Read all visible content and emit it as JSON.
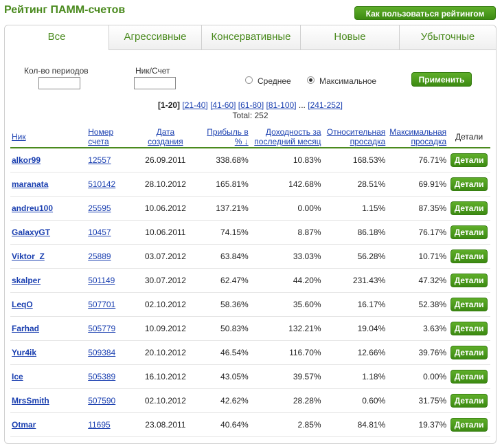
{
  "page": {
    "title": "Рейтинг ПАММ-счетов",
    "help_button": "Как пользоваться рейтингом"
  },
  "tabs": [
    {
      "label": "Все",
      "active": true
    },
    {
      "label": "Агрессивные",
      "active": false
    },
    {
      "label": "Консервативные",
      "active": false
    },
    {
      "label": "Новые",
      "active": false
    },
    {
      "label": "Убыточные",
      "active": false
    }
  ],
  "filters": {
    "periods_label": "Кол-во периодов",
    "periods_value": "",
    "nick_label": "Ник/Счет",
    "nick_value": "",
    "radio_average": "Среднее",
    "radio_max": "Максимальное",
    "selected": "Максимальное",
    "apply_button": "Применить"
  },
  "pager": {
    "current": "[1-20]",
    "links": [
      "[21-40]",
      "[41-60]",
      "[61-80]",
      "[81-100]"
    ],
    "ellipsis": "...",
    "last": "[241-252]",
    "total": "Total: 252"
  },
  "table": {
    "headers": {
      "nick": "Ник",
      "account_l1": "Номер",
      "account_l2": "счета",
      "created_l1": "Дата",
      "created_l2": "создания",
      "profit_l1": "Прибыль в",
      "profit_l2": "% ↓",
      "yield_l1": "Доходность за",
      "yield_l2": "последний месяц",
      "rel_l1": "Относительная",
      "rel_l2": "просадка",
      "max_l1": "Максимальная",
      "max_l2": "просадка",
      "details": "Детали"
    },
    "details_button": "Детали",
    "rows": [
      {
        "nick": "alkor99",
        "account": "12557",
        "created": "26.09.2011",
        "profit": "338.68%",
        "yield": "10.83%",
        "rel": "168.53%",
        "max": "76.71%"
      },
      {
        "nick": "maranata",
        "account": "510142",
        "created": "28.10.2012",
        "profit": "165.81%",
        "yield": "142.68%",
        "rel": "28.51%",
        "max": "69.91%"
      },
      {
        "nick": "andreu100",
        "account": "25595",
        "created": "10.06.2012",
        "profit": "137.21%",
        "yield": "0.00%",
        "rel": "1.15%",
        "max": "87.35%"
      },
      {
        "nick": "GalaxyGT",
        "account": "10457",
        "created": "10.06.2011",
        "profit": "74.15%",
        "yield": "8.87%",
        "rel": "86.18%",
        "max": "76.17%"
      },
      {
        "nick": "Viktor_Z",
        "account": "25889",
        "created": "03.07.2012",
        "profit": "63.84%",
        "yield": "33.03%",
        "rel": "56.28%",
        "max": "10.71%"
      },
      {
        "nick": "skalper",
        "account": "501149",
        "created": "30.07.2012",
        "profit": "62.47%",
        "yield": "44.20%",
        "rel": "231.43%",
        "max": "47.32%"
      },
      {
        "nick": "LeqO",
        "account": "507701",
        "created": "02.10.2012",
        "profit": "58.36%",
        "yield": "35.60%",
        "rel": "16.17%",
        "max": "52.38%"
      },
      {
        "nick": "Farhad",
        "account": "505779",
        "created": "10.09.2012",
        "profit": "50.83%",
        "yield": "132.21%",
        "rel": "19.04%",
        "max": "3.63%"
      },
      {
        "nick": "Yur4ik",
        "account": "509384",
        "created": "20.10.2012",
        "profit": "46.54%",
        "yield": "116.70%",
        "rel": "12.66%",
        "max": "39.76%"
      },
      {
        "nick": "Ice",
        "account": "505389",
        "created": "16.10.2012",
        "profit": "43.05%",
        "yield": "39.57%",
        "rel": "1.18%",
        "max": "0.00%"
      },
      {
        "nick": "MrsSmith",
        "account": "507590",
        "created": "02.10.2012",
        "profit": "42.62%",
        "yield": "28.28%",
        "rel": "0.60%",
        "max": "31.75%"
      },
      {
        "nick": "Otmar",
        "account": "11695",
        "created": "23.08.2011",
        "profit": "40.64%",
        "yield": "2.85%",
        "rel": "84.81%",
        "max": "19.37%"
      }
    ]
  }
}
